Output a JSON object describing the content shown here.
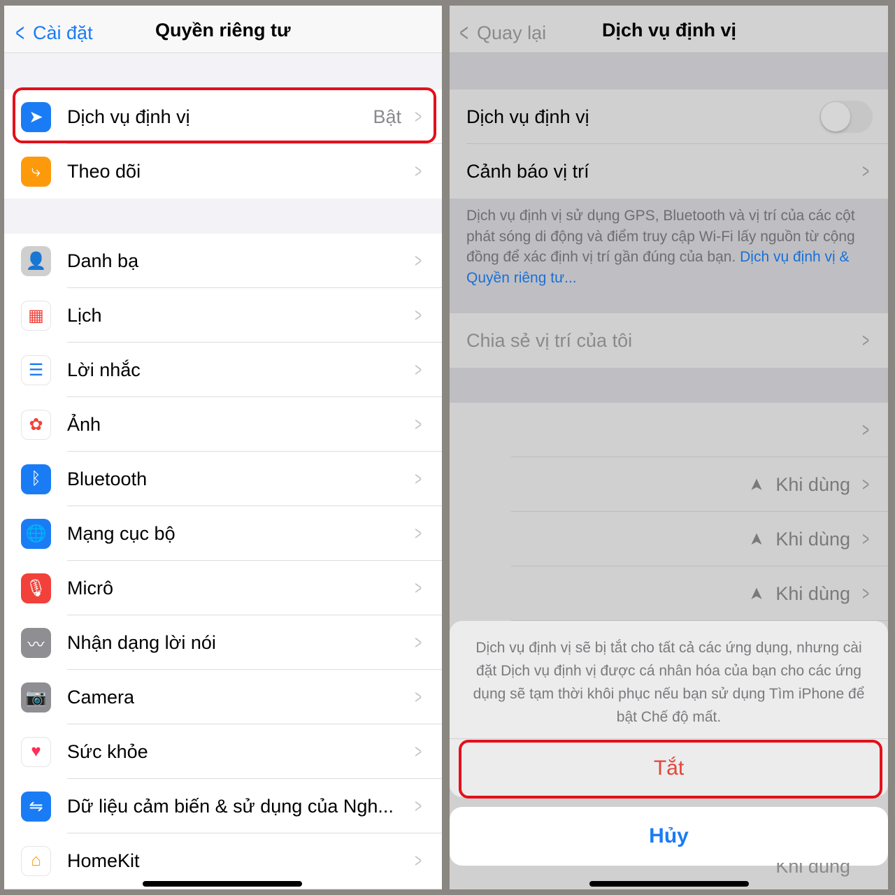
{
  "left": {
    "back_label": "Cài đặt",
    "title": "Quyền riêng tư",
    "group1": [
      {
        "label": "Dịch vụ định vị",
        "value": "Bật",
        "icon": "location-arrow-icon",
        "color": "#1a7cf5"
      },
      {
        "label": "Theo dõi",
        "icon": "tracking-icon",
        "color": "#fd9a0c"
      }
    ],
    "group2": [
      {
        "label": "Danh bạ",
        "icon": "contacts-icon",
        "color": "#cfcfcf"
      },
      {
        "label": "Lịch",
        "icon": "calendar-icon",
        "color": "#ffffff"
      },
      {
        "label": "Lời nhắc",
        "icon": "reminders-icon",
        "color": "#ffffff"
      },
      {
        "label": "Ảnh",
        "icon": "photos-icon",
        "color": "#ffffff"
      },
      {
        "label": "Bluetooth",
        "icon": "bluetooth-icon",
        "color": "#1a7cf5"
      },
      {
        "label": "Mạng cục bộ",
        "icon": "globe-icon",
        "color": "#1a7cf5"
      },
      {
        "label": "Micrô",
        "icon": "microphone-icon",
        "color": "#f2413a"
      },
      {
        "label": "Nhận dạng lời nói",
        "icon": "waveform-icon",
        "color": "#8e8e93"
      },
      {
        "label": "Camera",
        "icon": "camera-icon",
        "color": "#8e8e93"
      },
      {
        "label": "Sức khỏe",
        "icon": "heart-icon",
        "color": "#ffffff"
      },
      {
        "label": "Dữ liệu cảm biến & sử dụng của Ngh...",
        "icon": "sensor-data-icon",
        "color": "#1a7cf5"
      },
      {
        "label": "HomeKit",
        "icon": "home-icon",
        "color": "#ffffff"
      }
    ]
  },
  "right": {
    "back_label": "Quay lại",
    "title": "Dịch vụ định vị",
    "toggle_label": "Dịch vụ định vị",
    "toggle_on": false,
    "alerts_label": "Cảnh báo vị trí",
    "footer_text": "Dịch vụ định vị sử dụng GPS, Bluetooth và vị trí của các cột phát sóng di động và điểm truy cập Wi-Fi lấy nguồn từ cộng đồng để xác định vị trí gần đúng của bạn. ",
    "footer_link": "Dịch vụ định vị & Quyền riêng tư...",
    "share_label": "Chia sẻ vị trí của tôi",
    "app_rows": [
      "Khi dùng",
      "Khi dùng",
      "Khi dùng"
    ],
    "sheet_message": "Dịch vụ định vị sẽ bị tắt cho tất cả các ứng dụng, nhưng cài đặt Dịch vụ định vị được cá nhân hóa của bạn cho các ứng dụng sẽ tạm thời khôi phục nếu bạn sử dụng Tìm iPhone để bật Chế độ mất.",
    "turn_off_label": "Tắt",
    "cancel_label": "Hủy",
    "behind_label": "Khi dùng"
  },
  "colors": {
    "accent": "#1a7cf5",
    "destructive": "#e0453a",
    "highlight": "#e3101a"
  }
}
